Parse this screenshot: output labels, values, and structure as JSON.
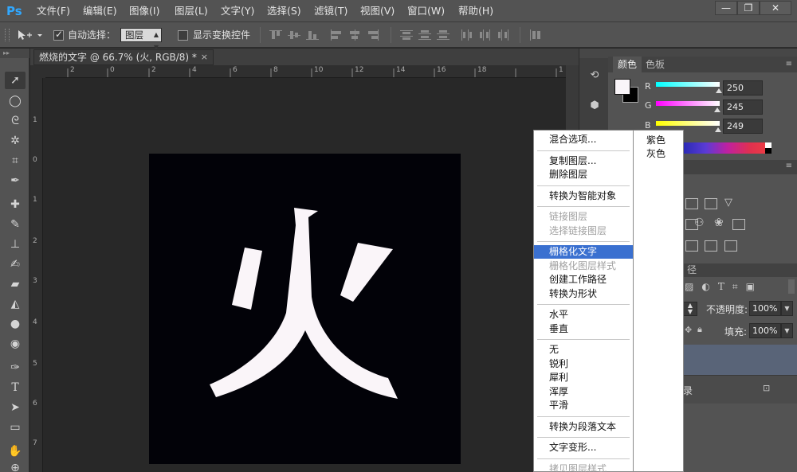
{
  "app": {
    "logo": "Ps"
  },
  "menubar": {
    "items": [
      "文件(F)",
      "编辑(E)",
      "图像(I)",
      "图层(L)",
      "文字(Y)",
      "选择(S)",
      "滤镜(T)",
      "视图(V)",
      "窗口(W)",
      "帮助(H)"
    ],
    "window_buttons": [
      "—",
      "❐",
      "✕"
    ]
  },
  "options": {
    "auto_select_label": "自动选择：",
    "auto_select_checked": true,
    "auto_select_value": "图层",
    "show_transform_label": "显示变换控件",
    "show_transform_checked": false
  },
  "document": {
    "tab_title": "燃烧的文字 @ 66.7% (火, RGB/8) *",
    "close_glyph": "×",
    "canvas_text": "火",
    "canvas_bg": "#020208",
    "text_color": "#faf5f9",
    "ruler_h_labels": [
      "2",
      "0",
      "2",
      "4",
      "6",
      "8",
      "10",
      "12",
      "14",
      "16",
      "18",
      "1"
    ],
    "ruler_v_labels": [
      "1",
      "0",
      "1",
      "2",
      "3",
      "4",
      "5",
      "6",
      "7"
    ]
  },
  "color_panel": {
    "tabs": [
      "颜色",
      "色板"
    ],
    "channels": [
      {
        "label": "R",
        "value": "250",
        "gradient_from": "#00ffff",
        "gradient_to": "#ffffff"
      },
      {
        "label": "G",
        "value": "245",
        "gradient_from": "#ff00ff",
        "gradient_to": "#ffffff"
      },
      {
        "label": "B",
        "value": "249",
        "gradient_from": "#ffff00",
        "gradient_to": "#ffffff"
      }
    ]
  },
  "layers_panel": {
    "tab_fragment": "径",
    "opacity_label": "不透明度:",
    "opacity_value": "100%",
    "fill_label": "填充:",
    "fill_value": "100%",
    "layer_fragment": "录"
  },
  "context_menu": {
    "items": [
      {
        "label": "混合选项...",
        "state": "normal"
      },
      {
        "sep": true
      },
      {
        "label": "复制图层...",
        "state": "normal"
      },
      {
        "label": "删除图层",
        "state": "normal"
      },
      {
        "sep": true
      },
      {
        "label": "转换为智能对象",
        "state": "normal"
      },
      {
        "sep": true
      },
      {
        "label": "链接图层",
        "state": "disabled"
      },
      {
        "label": "选择链接图层",
        "state": "disabled"
      },
      {
        "sep": true
      },
      {
        "label": "栅格化文字",
        "state": "hover"
      },
      {
        "label": "栅格化图层样式",
        "state": "disabled"
      },
      {
        "label": "创建工作路径",
        "state": "normal"
      },
      {
        "label": "转换为形状",
        "state": "normal"
      },
      {
        "sep": true
      },
      {
        "label": "水平",
        "state": "normal"
      },
      {
        "label": "垂直",
        "state": "normal"
      },
      {
        "sep": true
      },
      {
        "label": "无",
        "state": "normal"
      },
      {
        "label": "锐利",
        "state": "normal"
      },
      {
        "label": "犀利",
        "state": "normal"
      },
      {
        "label": "浑厚",
        "state": "normal"
      },
      {
        "label": "平滑",
        "state": "normal"
      },
      {
        "sep": true
      },
      {
        "label": "转换为段落文本",
        "state": "normal"
      },
      {
        "sep": true
      },
      {
        "label": "文字变形...",
        "state": "normal"
      },
      {
        "sep": true
      },
      {
        "label": "拷贝图层样式",
        "state": "disabled"
      }
    ],
    "submenu": [
      "紫色",
      "灰色"
    ]
  }
}
